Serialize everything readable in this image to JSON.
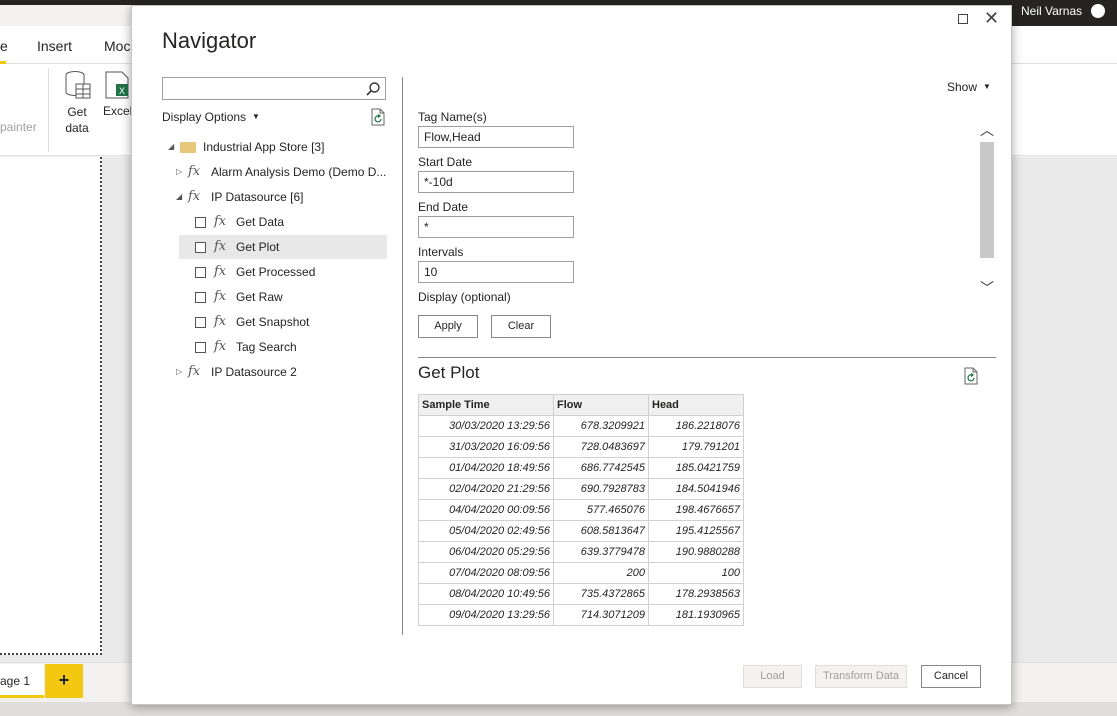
{
  "app": {
    "user_name": "Neil Varnas",
    "tabs": [
      "e",
      "Insert",
      "Moc"
    ],
    "painter_label": "painter",
    "get_data_label": "Get data",
    "excel_label": "Excel",
    "page_tab": "age 1",
    "add_page": "+"
  },
  "dialog": {
    "title": "Navigator",
    "search": {
      "value": "",
      "placeholder": ""
    },
    "display_options": "Display Options",
    "show": "Show",
    "tree": [
      {
        "label": "Industrial App Store [3]",
        "type": "folder",
        "level": 0,
        "expanded": true
      },
      {
        "label": "Alarm Analysis Demo (Demo D...",
        "type": "fx",
        "level": 1,
        "expanded": false
      },
      {
        "label": "IP Datasource [6]",
        "type": "fx",
        "level": 1,
        "expanded": true
      },
      {
        "label": "Get Data",
        "type": "fx-item",
        "level": 2,
        "checked": false
      },
      {
        "label": "Get Plot",
        "type": "fx-item",
        "level": 2,
        "checked": false,
        "selected": true
      },
      {
        "label": "Get Processed",
        "type": "fx-item",
        "level": 2,
        "checked": false
      },
      {
        "label": "Get Raw",
        "type": "fx-item",
        "level": 2,
        "checked": false
      },
      {
        "label": "Get Snapshot",
        "type": "fx-item",
        "level": 2,
        "checked": false
      },
      {
        "label": "Tag Search",
        "type": "fx-item",
        "level": 2,
        "checked": false
      },
      {
        "label": "IP Datasource 2",
        "type": "fx",
        "level": 1,
        "expanded": false
      }
    ],
    "params": {
      "tag_names_label": "Tag Name(s)",
      "tag_names_value": "Flow,Head",
      "start_date_label": "Start Date",
      "start_date_value": "*-10d",
      "end_date_label": "End Date",
      "end_date_value": "*",
      "intervals_label": "Intervals",
      "intervals_value": "10",
      "display_label": "Display (optional)"
    },
    "apply_label": "Apply",
    "clear_label": "Clear",
    "preview_title": "Get Plot",
    "table": {
      "columns": [
        "Sample Time",
        "Flow",
        "Head"
      ],
      "rows": [
        [
          "30/03/2020 13:29:56",
          "678.3209921",
          "186.2218076"
        ],
        [
          "31/03/2020 16:09:56",
          "728.0483697",
          "179.791201"
        ],
        [
          "01/04/2020 18:49:56",
          "686.7742545",
          "185.0421759"
        ],
        [
          "02/04/2020 21:29:56",
          "690.7928783",
          "184.5041946"
        ],
        [
          "04/04/2020 00:09:56",
          "577.465076",
          "198.4676657"
        ],
        [
          "05/04/2020 02:49:56",
          "608.5813647",
          "195.4125567"
        ],
        [
          "06/04/2020 05:29:56",
          "639.3779478",
          "190.9880288"
        ],
        [
          "07/04/2020 08:09:56",
          "200",
          "100"
        ],
        [
          "08/04/2020 10:49:56",
          "735.4372865",
          "178.2938563"
        ],
        [
          "09/04/2020 13:29:56",
          "714.3071209",
          "181.1930965"
        ]
      ]
    },
    "load_label": "Load",
    "transform_label": "Transform Data",
    "cancel_label": "Cancel",
    "colors": {
      "accent": "#f2c811",
      "selected_row": "#e8e8e8",
      "folder": "#e8c77a"
    }
  }
}
